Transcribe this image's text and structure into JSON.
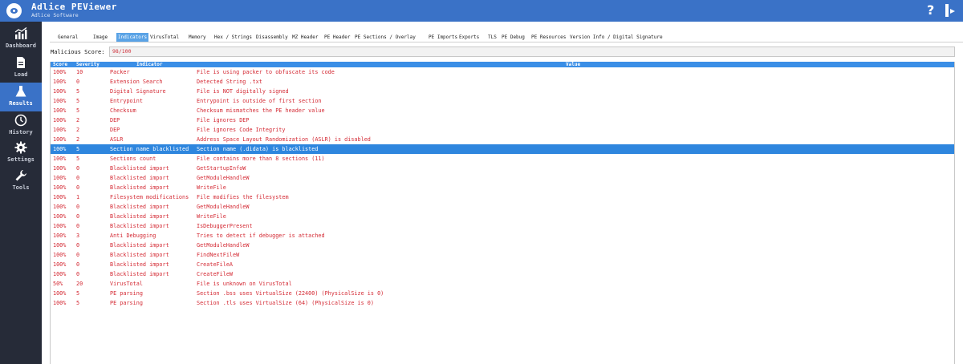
{
  "app": {
    "title": "Adlice PEViewer",
    "subtitle": "Adlice Software"
  },
  "titlebar": {
    "help_label": "?"
  },
  "sidebar": {
    "items": [
      {
        "label": "Dashboard",
        "icon": "chart-icon",
        "active": false
      },
      {
        "label": "Load",
        "icon": "file-icon",
        "active": false
      },
      {
        "label": "Results",
        "icon": "flask-icon",
        "active": true
      },
      {
        "label": "History",
        "icon": "clock-icon",
        "active": false
      },
      {
        "label": "Settings",
        "icon": "gear-icon",
        "active": false
      },
      {
        "label": "Tools",
        "icon": "wrench-icon",
        "active": false
      }
    ]
  },
  "tabs": [
    "General",
    "Image",
    "Indicators",
    "VirusTotal",
    "Memory",
    "Hex / Strings",
    "Disassembly",
    "MZ Header",
    "PE Header",
    "PE Sections / Overlay",
    "PE Imports",
    "Exports",
    "TLS",
    "PE Debug",
    "PE Resources",
    "Version Info / Digital Signature"
  ],
  "active_tab": "Indicators",
  "score": {
    "label": "Malicious Score:",
    "value": "98/100"
  },
  "table": {
    "headers": {
      "score": "Score",
      "severity": "Severity",
      "indicator": "Indicator",
      "value": "Value"
    },
    "rows": [
      {
        "score": "100%",
        "severity": "10",
        "indicator": "Packer",
        "value": "File is using packer to obfuscate its code"
      },
      {
        "score": "100%",
        "severity": "0",
        "indicator": "Extension Search",
        "value": "Detected String  .txt"
      },
      {
        "score": "100%",
        "severity": "5",
        "indicator": "Digital Signature",
        "value": "File is NOT digitally signed"
      },
      {
        "score": "100%",
        "severity": "5",
        "indicator": "Entrypoint",
        "value": "Entrypoint is outside of first section"
      },
      {
        "score": "100%",
        "severity": "5",
        "indicator": "Checksum",
        "value": "Checksum mismatches the PE header value"
      },
      {
        "score": "100%",
        "severity": "2",
        "indicator": "DEP",
        "value": "File ignores DEP"
      },
      {
        "score": "100%",
        "severity": "2",
        "indicator": "DEP",
        "value": "File ignores Code Integrity"
      },
      {
        "score": "100%",
        "severity": "2",
        "indicator": "ASLR",
        "value": "Address Space Layout Randomization (ASLR) is disabled"
      },
      {
        "score": "100%",
        "severity": "5",
        "indicator": "Section name blacklisted",
        "value": "Section name (.didata) is blacklisted"
      },
      {
        "score": "100%",
        "severity": "5",
        "indicator": "Sections count",
        "value": "File contains more than 8 sections (11)"
      },
      {
        "score": "100%",
        "severity": "0",
        "indicator": "Blacklisted import",
        "value": "GetStartupInfoW"
      },
      {
        "score": "100%",
        "severity": "0",
        "indicator": "Blacklisted import",
        "value": "GetModuleHandleW"
      },
      {
        "score": "100%",
        "severity": "0",
        "indicator": "Blacklisted import",
        "value": "WriteFile"
      },
      {
        "score": "100%",
        "severity": "1",
        "indicator": "Filesystem modifications",
        "value": "File modifies the filesystem"
      },
      {
        "score": "100%",
        "severity": "0",
        "indicator": "Blacklisted import",
        "value": "GetModuleHandleW"
      },
      {
        "score": "100%",
        "severity": "0",
        "indicator": "Blacklisted import",
        "value": "WriteFile"
      },
      {
        "score": "100%",
        "severity": "0",
        "indicator": "Blacklisted import",
        "value": "IsDebuggerPresent"
      },
      {
        "score": "100%",
        "severity": "3",
        "indicator": "Anti Debugging",
        "value": "Tries to detect if debugger is attached"
      },
      {
        "score": "100%",
        "severity": "0",
        "indicator": "Blacklisted import",
        "value": "GetModuleHandleW"
      },
      {
        "score": "100%",
        "severity": "0",
        "indicator": "Blacklisted import",
        "value": "FindNextFileW"
      },
      {
        "score": "100%",
        "severity": "0",
        "indicator": "Blacklisted import",
        "value": "CreateFileA"
      },
      {
        "score": "100%",
        "severity": "0",
        "indicator": "Blacklisted import",
        "value": "CreateFileW"
      },
      {
        "score": "50%",
        "severity": "20",
        "indicator": "VirusTotal",
        "value": "File is unknown on VirusTotal"
      },
      {
        "score": "100%",
        "severity": "5",
        "indicator": "PE parsing",
        "value": "Section .bss uses VirtualSize (22400) (PhysicalSize is 0)"
      },
      {
        "score": "100%",
        "severity": "5",
        "indicator": "PE parsing",
        "value": "Section .tls uses VirtualSize (64) (PhysicalSize is 0)"
      }
    ],
    "selected_row": 8
  },
  "colors": {
    "accent": "#3a72c7",
    "sidebar_bg": "#262b38",
    "danger_text": "#d42a34",
    "selection": "#2e86de"
  }
}
